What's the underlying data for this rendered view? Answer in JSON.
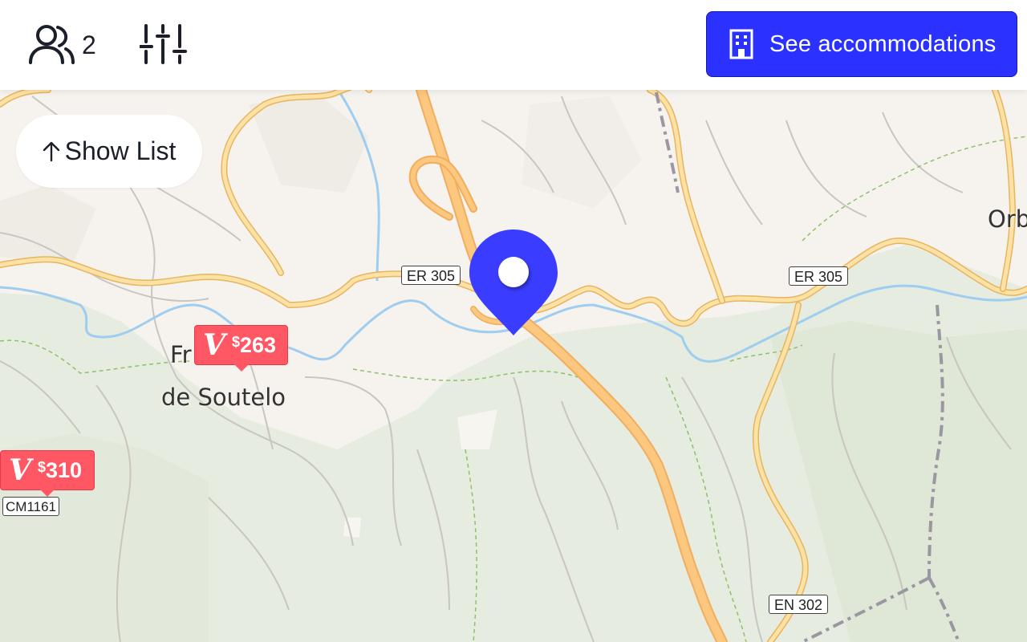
{
  "header": {
    "guests_count": "2",
    "guests_icon": "users-icon",
    "filters_icon": "sliders-icon",
    "cta_label": "See accommodations",
    "cta_icon": "building-icon"
  },
  "map": {
    "show_list_label": "Show List",
    "show_list_icon": "arrow-up-icon",
    "road_labels": [
      "ER 305",
      "ER 305",
      "CM1161",
      "EN 302"
    ],
    "place_labels": [
      "Fr",
      "de Soutelo",
      "Orb"
    ],
    "price_markers": [
      {
        "currency": "$",
        "amount": "263",
        "brand": "V"
      },
      {
        "currency": "$",
        "amount": "310",
        "brand": "V"
      }
    ],
    "location_pin": "map-pin-icon"
  },
  "colors": {
    "accent": "#2b32ff",
    "price_marker": "#ff5864",
    "land": "#f6f3ef",
    "forest": "#e6ecdf",
    "major_road": "#f7c27a",
    "river": "#9fcdf0",
    "border_line": "#9a97a1"
  }
}
